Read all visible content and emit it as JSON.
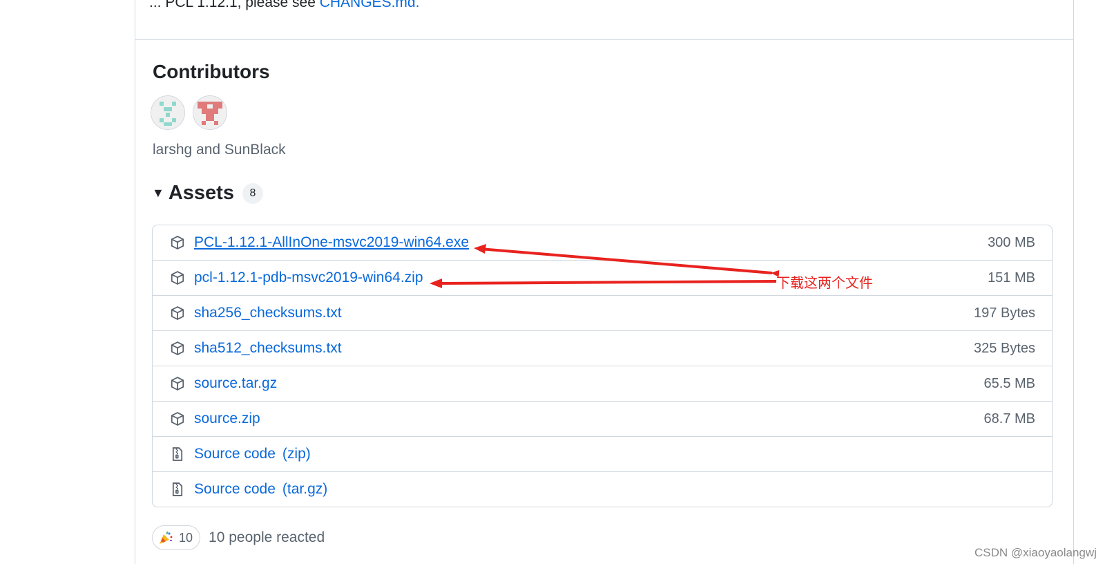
{
  "top": {
    "text": "... PCL 1.12.1, please see ",
    "link": "CHANGES.md."
  },
  "contributors": {
    "title": "Contributors",
    "names": "larshg and SunBlack"
  },
  "assets": {
    "title": "Assets",
    "count": "8",
    "items": [
      {
        "name": "PCL-1.12.1-AllInOne-msvc2019-win64.exe",
        "suffix": "",
        "size": "300 MB"
      },
      {
        "name": "pcl-1.12.1-pdb-msvc2019-win64.zip",
        "suffix": "",
        "size": "151 MB"
      },
      {
        "name": "sha256_checksums.txt",
        "suffix": "",
        "size": "197 Bytes"
      },
      {
        "name": "sha512_checksums.txt",
        "suffix": "",
        "size": "325 Bytes"
      },
      {
        "name": "source.tar.gz",
        "suffix": "",
        "size": "65.5 MB"
      },
      {
        "name": "source.zip",
        "suffix": "",
        "size": "68.7 MB"
      },
      {
        "name": "Source code",
        "suffix": "(zip)",
        "size": ""
      },
      {
        "name": "Source code",
        "suffix": "(tar.gz)",
        "size": ""
      }
    ]
  },
  "reactions": {
    "count": "10",
    "text": "10 people reacted",
    "emoji": "tada-icon"
  },
  "annotation": {
    "text": "下载这两个文件",
    "color": "#e8231f"
  },
  "watermark": "CSDN @xiaoyaolangwj",
  "colors": {
    "link": "#0969da",
    "muted": "#59636e",
    "border": "#d0d7de"
  }
}
